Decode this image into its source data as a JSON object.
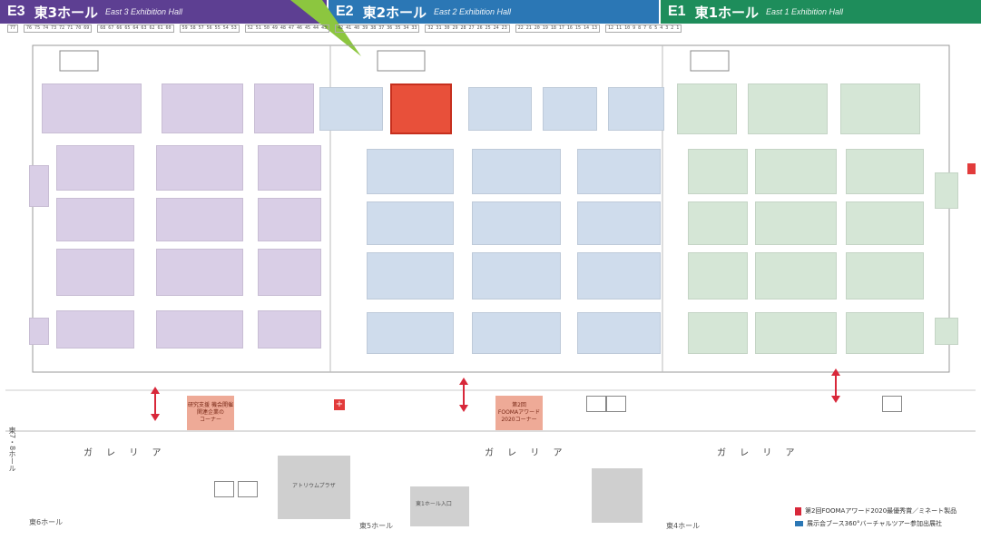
{
  "halls": [
    {
      "code": "E3",
      "jp": "東3ホール",
      "en": "East 3 Exhibition Hall",
      "color": "#5d3f92"
    },
    {
      "code": "E2",
      "jp": "東2ホール",
      "en": "East 2 Exhibition Hall",
      "color": "#2b77b5"
    },
    {
      "code": "E1",
      "jp": "東1ホール",
      "en": "East 1 Exhibition Hall",
      "color": "#1e8d5b"
    }
  ],
  "galleria": [
    "ガ レ リ ア",
    "ガ レ リ ア",
    "ガ レ リ ア"
  ],
  "corners": [
    "研究支援 機会開催\n関連企業の\nコーナー",
    "第2回\nFOOMAアワード\n2020コーナー"
  ],
  "exits": {
    "left_vertical": "東7・8ホール",
    "bottom_left": "東6ホール",
    "bottom_center": "東5ホール",
    "bottom_right": "東4ホール"
  },
  "plaza": "アトリウムプラザ",
  "entrance": "東1ホール入口",
  "legend": [
    "第2回FOOMAアワード2020最優秀賞／ミネート製品",
    "展示会ブース360°バーチャルツアー参加出展社"
  ],
  "colors": {
    "e3": "#d9cee6",
    "e2": "#cfdcec",
    "e1": "#d5e6d6",
    "highlight": "#e8503a",
    "arrow": "#d8283a",
    "pointer": "#8cc63f"
  }
}
